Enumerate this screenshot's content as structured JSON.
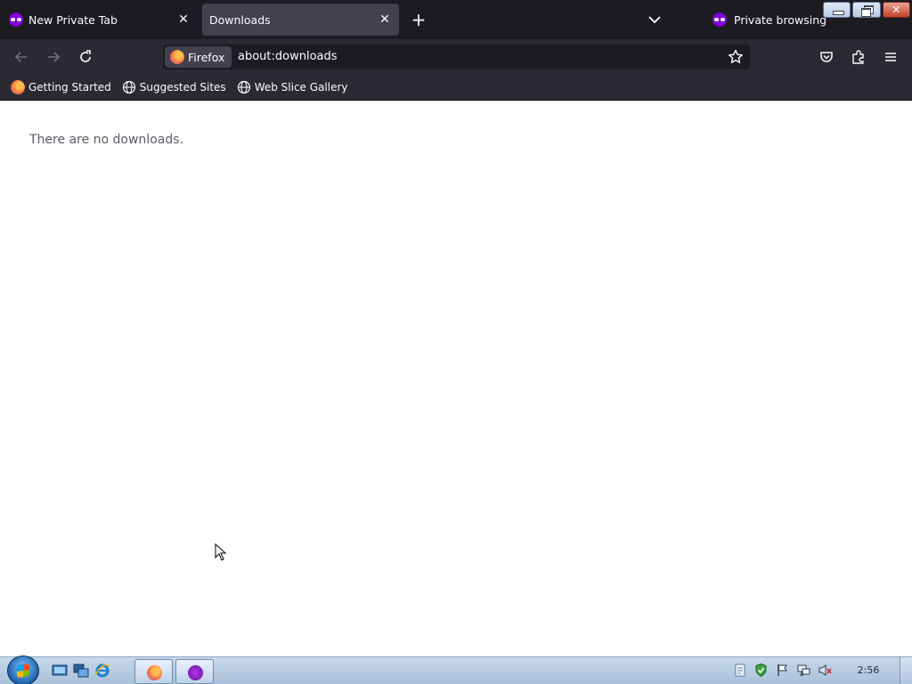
{
  "browser": {
    "tabs": [
      {
        "label": "New Private Tab",
        "active": false
      },
      {
        "label": "Downloads",
        "active": true
      }
    ],
    "new_tab_label": "+",
    "private_indicator": "Private browsing",
    "identity_label": "Firefox",
    "url": "about:downloads",
    "bookmarks": [
      {
        "label": "Getting Started",
        "icon": "firefox-icon"
      },
      {
        "label": "Suggested Sites",
        "icon": "globe-icon"
      },
      {
        "label": "Web Slice Gallery",
        "icon": "globe-icon"
      }
    ]
  },
  "content": {
    "empty_message": "There are no downloads."
  },
  "taskbar": {
    "clock": "2:56"
  },
  "colors": {
    "tabbar_bg": "#1c1b22",
    "toolbar_bg": "#2b2a33",
    "selected_tab_bg": "#42414d",
    "private_purple": "#8000d7",
    "page_bg": "#ffffff"
  }
}
